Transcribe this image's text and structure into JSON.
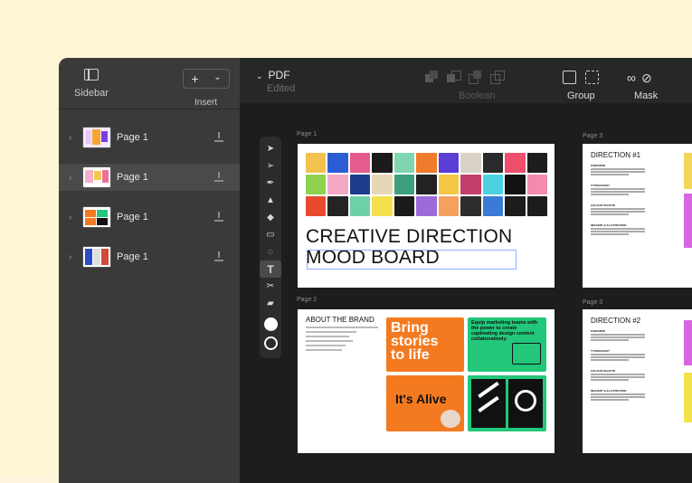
{
  "sidebar": {
    "toggle_label": "Sidebar",
    "insert_symbol": "+",
    "insert_chevron": "⌄",
    "insert_label": "Insert",
    "pages": [
      {
        "label": "Page 1",
        "selected": false
      },
      {
        "label": "Page 1",
        "selected": true
      },
      {
        "label": "Page 1",
        "selected": false
      },
      {
        "label": "Page 1",
        "selected": false
      }
    ]
  },
  "topbar": {
    "doc_title": "PDF",
    "doc_status": "Edited",
    "boolean_label": "Boolean",
    "group_label": "Group",
    "mask_label": "Mask"
  },
  "canvas": {
    "page_labels": [
      "Page 1",
      "Page 2",
      "Page 3",
      "Page 3"
    ],
    "slide1": {
      "heading_line1": "CREATIVE DIRECTION",
      "heading_line2": "MOOD BOARD"
    },
    "slide2": {
      "title": "ABOUT THE BRAND",
      "card1": "Bring stories to life",
      "card2": "Equip marketing teams with the power to create captivating design content collaboratively.",
      "card3": "It's Alive"
    },
    "slide3a": {
      "title": "DIRECTION #1"
    },
    "slide3b": {
      "title": "DIRECTION #2"
    },
    "section_heads": [
      "OVERVIEW",
      "TYPOGRAPHY",
      "COLOUR PALETTE",
      "IMAGERY & ILLUSTRATION"
    ]
  },
  "colors": {
    "orange": "#f47a1f",
    "green": "#22c77a",
    "dark": "#1c1e1e"
  }
}
